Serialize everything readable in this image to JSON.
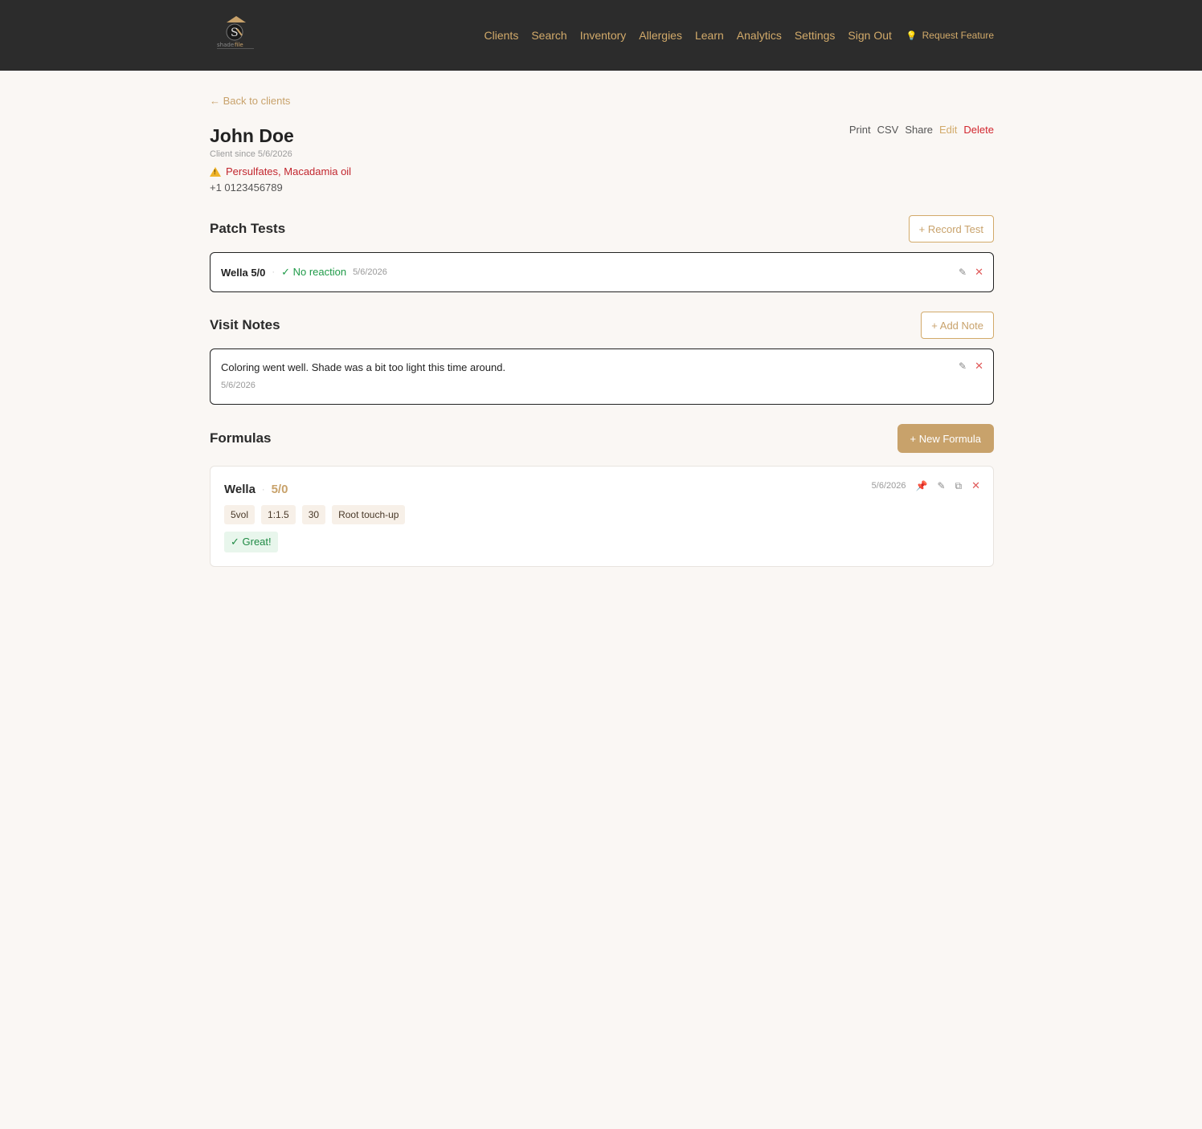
{
  "brand": {
    "logo_text": "shadefile"
  },
  "nav": {
    "items": [
      "Clients",
      "Search",
      "Inventory",
      "Allergies",
      "Learn",
      "Analytics",
      "Settings",
      "Sign Out"
    ],
    "request_feature": "Request Feature"
  },
  "client": {
    "back_label": "← Back to clients",
    "name": "John Doe",
    "since": "Client since 5/6/2026",
    "allergies": "Persulfates, Macadamia oil",
    "phone": "+1 0123456789",
    "actions": {
      "print": "Print",
      "csv": "CSV",
      "share": "Share",
      "edit": "Edit",
      "delete": "Delete"
    }
  },
  "patch_tests": {
    "title": "Patch Tests",
    "button": "+ Record Test",
    "items": [
      {
        "product": "Wella 5/0",
        "result": "✓ No reaction",
        "date": "5/6/2026"
      }
    ]
  },
  "visit_notes": {
    "title": "Visit Notes",
    "button": "+ Add Note",
    "items": [
      {
        "text": "Coloring went well. Shade was a bit too light this time around.",
        "date": "5/6/2026"
      }
    ]
  },
  "formulas": {
    "title": "Formulas",
    "button": "+ New Formula",
    "items": [
      {
        "brand": "Wella",
        "shade": "5/0",
        "date": "5/6/2026",
        "chips": [
          "5vol",
          "1:1.5",
          "30",
          "Root touch-up"
        ],
        "result": "✓ Great!"
      }
    ]
  },
  "icons": {
    "edit": "✎",
    "delete": "✕",
    "pin": "📌",
    "copy": "⧉",
    "bulb": "💡"
  },
  "colors": {
    "accent": "#c8a26b",
    "danger": "#d2262e",
    "success": "#1f9a48",
    "header_bg": "#2c2c2c"
  }
}
